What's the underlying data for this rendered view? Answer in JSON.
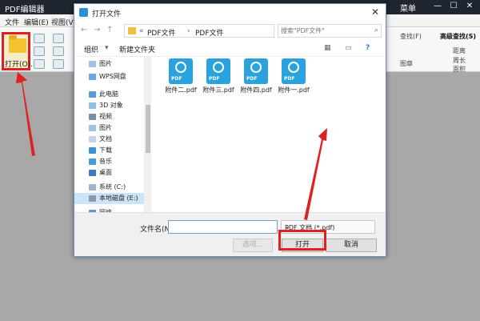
{
  "app": {
    "title": "PDF编辑器",
    "menu_label": "菜单",
    "menubar": [
      "文件",
      "编辑(E)",
      "视图(V)"
    ],
    "open_label": "打开(O)...",
    "right_tools": {
      "find": "查找(F)",
      "advanced_find": "高级查找(S)",
      "distance": "距离",
      "perimeter": "周长",
      "area": "面积",
      "shape": "图章"
    }
  },
  "dialog": {
    "title": "打开文件",
    "close": "✕",
    "address": [
      "PDF文件",
      "PDF文件"
    ],
    "search_placeholder": "搜索\"PDF文件\"",
    "commands": {
      "organize": "组织",
      "new_folder": "新建文件夹"
    },
    "sidebar": [
      {
        "label": "图片",
        "icon": "pictures-icon",
        "color": "#9fc4e0"
      },
      {
        "label": "WPS网盘",
        "icon": "cloud-icon",
        "color": "#6aa6e8"
      },
      {
        "label": "此电脑",
        "icon": "computer-icon",
        "color": "#5a9bd5"
      },
      {
        "label": "3D 对象",
        "icon": "cube-icon",
        "color": "#8cc0e6"
      },
      {
        "label": "视频",
        "icon": "video-icon",
        "color": "#7a8fa8"
      },
      {
        "label": "图片",
        "icon": "pictures-icon",
        "color": "#9fc4e0"
      },
      {
        "label": "文档",
        "icon": "documents-icon",
        "color": "#c5d5e6"
      },
      {
        "label": "下载",
        "icon": "download-icon",
        "color": "#3d8fd6"
      },
      {
        "label": "音乐",
        "icon": "music-icon",
        "color": "#4a9ad8"
      },
      {
        "label": "桌面",
        "icon": "desktop-icon",
        "color": "#3a7cc2"
      },
      {
        "label": "系统 (C:)",
        "icon": "drive-icon",
        "color": "#a0b4c8"
      },
      {
        "label": "本地磁盘 (E:)",
        "icon": "drive-icon",
        "color": "#8a9aaa",
        "selected": true
      },
      {
        "label": "网络",
        "icon": "network-icon",
        "color": "#5a9bd5"
      }
    ],
    "files": [
      {
        "name": "附件二.pdf"
      },
      {
        "name": "附件三.pdf"
      },
      {
        "name": "附件四.pdf"
      },
      {
        "name": "附件一.pdf"
      }
    ],
    "file_icon_text": "PDF",
    "filename_label": "文件名(N):",
    "filename_value": "",
    "filetype": "PDF 文档 (*.pdf)",
    "tools_button": "选项...",
    "open_button": "打开",
    "cancel_button": "取消"
  },
  "colors": {
    "highlight": "#e02020",
    "accent": "#29a3de"
  }
}
